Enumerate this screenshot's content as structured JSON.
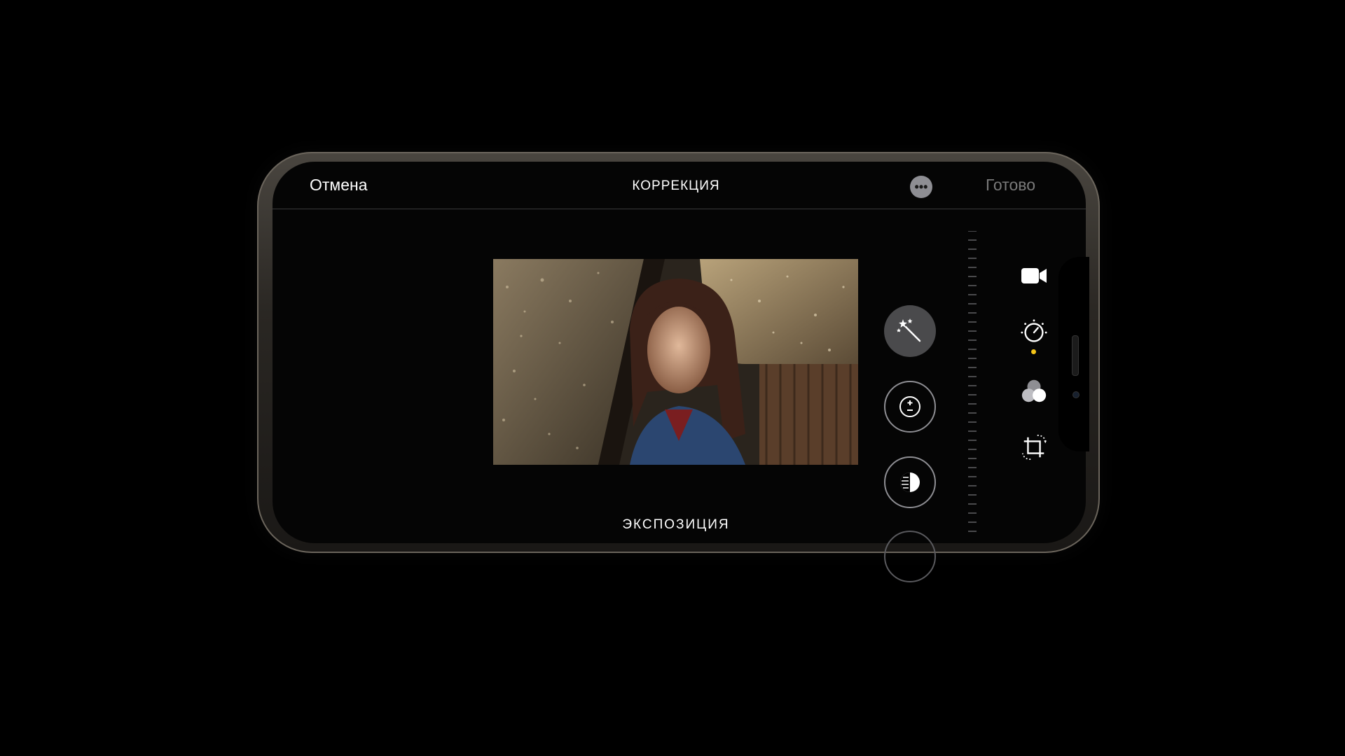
{
  "header": {
    "cancel_label": "Отмена",
    "title": "КОРРЕКЦИЯ",
    "more_icon": "ellipsis-icon",
    "done_label": "Готово"
  },
  "editor": {
    "tools": [
      {
        "name": "auto",
        "icon": "magic-wand-icon"
      },
      {
        "name": "exposure",
        "icon": "plus-minus-icon"
      },
      {
        "name": "brilliance",
        "icon": "half-circle-icon"
      }
    ],
    "selected_tool_label": "ЭКСПОЗИЦИЯ"
  },
  "sidebar": {
    "items": [
      {
        "name": "video",
        "icon": "video-camera-icon"
      },
      {
        "name": "adjust",
        "icon": "adjust-dial-icon",
        "active": true
      },
      {
        "name": "filters",
        "icon": "filters-icon"
      },
      {
        "name": "crop",
        "icon": "crop-rotate-icon"
      }
    ]
  },
  "colors": {
    "accent": "#f5c518",
    "text": "#ffffff",
    "muted": "#7a7a7a",
    "background": "#000000"
  }
}
